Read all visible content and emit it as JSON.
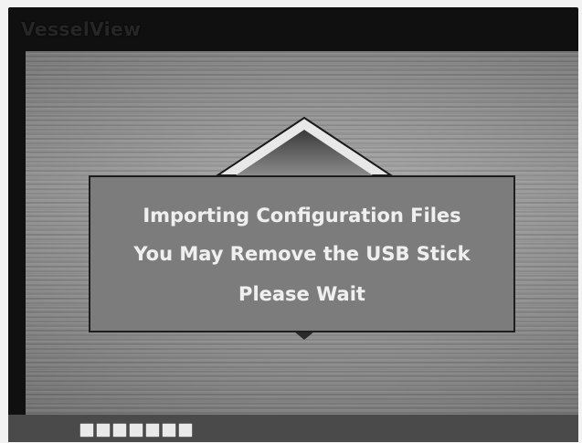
{
  "device": {
    "logo_text": "VesselView"
  },
  "dialog": {
    "line1": "Importing Configuration Files",
    "line2": "You May Remove the USB Stick",
    "line3": "Please Wait"
  },
  "progress": {
    "segments_shown": 7,
    "label": ""
  },
  "colors": {
    "screen_background": "#9a9a9a",
    "dialog_background": "#7c7c7c",
    "dialog_text": "#efefef",
    "bezel": "#101010"
  },
  "icons": {
    "arrow": "up-arrow-icon"
  }
}
